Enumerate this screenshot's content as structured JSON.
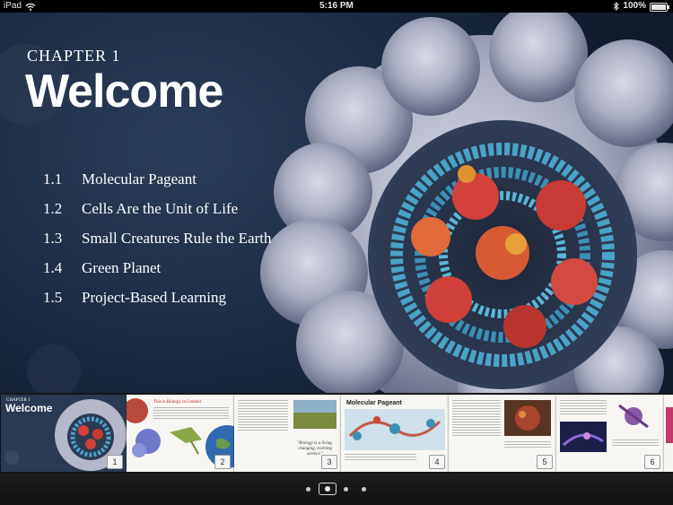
{
  "status_bar": {
    "device": "iPad",
    "time": "5:16 PM",
    "battery": "100%",
    "battery_level": 1.0
  },
  "chapter": {
    "label": "CHAPTER 1",
    "title": "Welcome"
  },
  "toc": [
    {
      "num": "1.1",
      "title": "Molecular Pageant"
    },
    {
      "num": "1.2",
      "title": "Cells Are the Unit of Life"
    },
    {
      "num": "1.3",
      "title": "Small Creatures Rule the Earth"
    },
    {
      "num": "1.4",
      "title": "Green Planet"
    },
    {
      "num": "1.5",
      "title": "Project-Based Learning"
    }
  ],
  "thumbnails": {
    "cover_label": "CHAPTER 1",
    "cover_title": "Welcome",
    "page2_heading": "This is Biology in Context",
    "page3_quote": "\"Biology is a living, changing, evolving science.\"",
    "page4_heading": "Molecular Pageant",
    "page_numbers": [
      "1",
      "2",
      "3",
      "4",
      "5",
      "6"
    ]
  },
  "pager": {
    "pages": 4,
    "active_index": 1
  },
  "colors": {
    "protein_shell": "#b9bccc",
    "dna_blue": "#4aa3c8",
    "histone_red": "#d2423a"
  }
}
